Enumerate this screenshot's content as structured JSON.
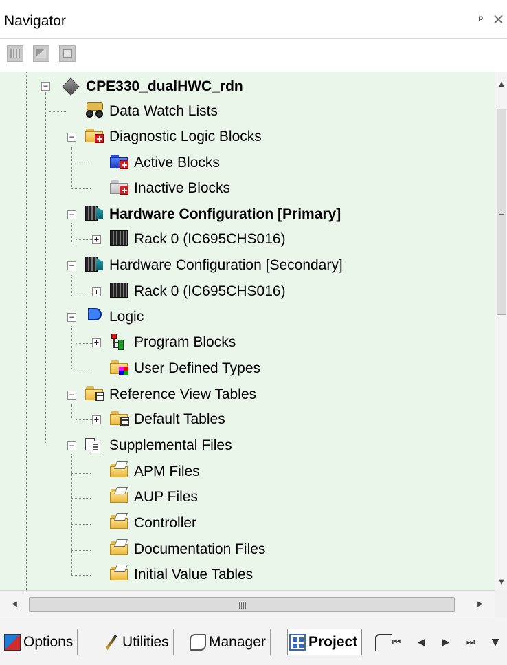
{
  "window": {
    "title": "Navigator",
    "pin_glyph": "ᵖ",
    "close_glyph": "×"
  },
  "toolbar": {
    "buttons": [
      {
        "name": "toolbar-view-icon"
      },
      {
        "name": "toolbar-properties-icon"
      },
      {
        "name": "toolbar-blank-icon"
      }
    ]
  },
  "tree": {
    "items": [
      {
        "label": "CPE330_dualHWC_rdn",
        "icon": "target-diamond-icon",
        "bold": true
      },
      {
        "label": "Data Watch Lists",
        "icon": "watch-lists-icon",
        "bold": false
      },
      {
        "label": "Diagnostic Logic Blocks",
        "icon": "folder-red-cross-icon",
        "bold": false
      },
      {
        "label": "Active Blocks",
        "icon": "blue-folder-red-cross-icon",
        "bold": false
      },
      {
        "label": "Inactive Blocks",
        "icon": "gray-folder-red-cross-icon",
        "bold": false
      },
      {
        "label": "Hardware Configuration [Primary]",
        "icon": "hardware-config-icon",
        "bold": true
      },
      {
        "label": "Rack 0 (IC695CHS016)",
        "icon": "rack-icon",
        "bold": false
      },
      {
        "label": "Hardware Configuration [Secondary]",
        "icon": "hardware-config-icon",
        "bold": false
      },
      {
        "label": "Rack 0 (IC695CHS016)",
        "icon": "rack-icon",
        "bold": false
      },
      {
        "label": "Logic",
        "icon": "logic-gate-icon",
        "bold": false
      },
      {
        "label": "Program Blocks",
        "icon": "program-blocks-icon",
        "bold": false
      },
      {
        "label": "User Defined Types",
        "icon": "folder-colors-icon",
        "bold": false
      },
      {
        "label": "Reference View Tables",
        "icon": "folder-table-icon",
        "bold": false
      },
      {
        "label": "Default Tables",
        "icon": "folder-table-icon",
        "bold": false
      },
      {
        "label": "Supplemental Files",
        "icon": "supplemental-files-icon",
        "bold": false
      },
      {
        "label": "APM Files",
        "icon": "folder-open-icon",
        "bold": false
      },
      {
        "label": "AUP Files",
        "icon": "folder-open-icon",
        "bold": false
      },
      {
        "label": "Controller",
        "icon": "folder-open-icon",
        "bold": false
      },
      {
        "label": "Documentation Files",
        "icon": "folder-open-icon",
        "bold": false
      },
      {
        "label": "Initial Value Tables",
        "icon": "folder-open-icon",
        "bold": false
      }
    ],
    "collapse_glyph": "−",
    "expand_glyph": "+"
  },
  "scrollbars": {
    "up_glyph": "▲",
    "down_glyph": "▼",
    "left_glyph": "◀",
    "right_glyph": "▶"
  },
  "tabs": {
    "items": [
      {
        "label": "Options",
        "active": false
      },
      {
        "label": "Utilities",
        "active": false
      },
      {
        "label": "Manager",
        "active": false
      },
      {
        "label": "Project",
        "active": true
      }
    ],
    "nav": {
      "first": "⏮",
      "prev": "◀",
      "next": "▶",
      "last": "⏭",
      "menu": "▼"
    }
  }
}
